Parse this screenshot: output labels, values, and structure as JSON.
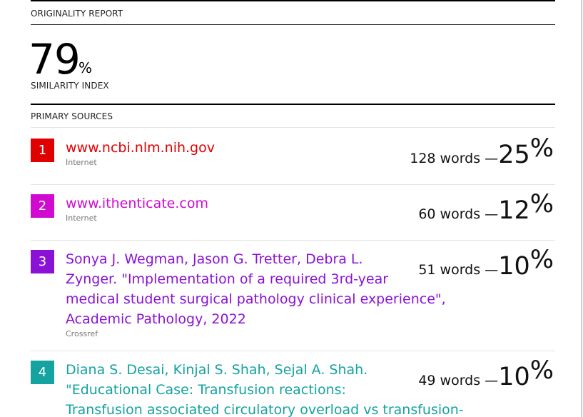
{
  "report": {
    "header_label": "ORIGINALITY REPORT",
    "similarity_value": "79",
    "similarity_unit": "%",
    "similarity_label": "SIMILARITY INDEX",
    "sources_label": "PRIMARY SOURCES"
  },
  "sources": [
    {
      "number": "1",
      "title_lines": [
        "www.ncbi.nlm.nih.gov"
      ],
      "type": "Internet",
      "words": "128 words —",
      "percent": "25",
      "color": "#e00000"
    },
    {
      "number": "2",
      "title_lines": [
        "www.ithenticate.com"
      ],
      "type": "Internet",
      "words": "60 words —",
      "percent": "12",
      "color": "#d10ad1"
    },
    {
      "number": "3",
      "title_lines": [
        "Sonya J. Wegman, Jason G. Tretter, Debra L.",
        "Zynger. \"Implementation of a required 3rd-year",
        "medical student surgical pathology clinical experience\",",
        "Academic Pathology, 2022"
      ],
      "type": "Crossref",
      "words": "51 words —",
      "percent": "10",
      "color": "#8a12d6"
    },
    {
      "number": "4",
      "title_lines": [
        "Diana S. Desai, Kinjal S. Shah, Sejal A. Shah.",
        "\"Educational Case: Transfusion reactions:",
        "Transfusion associated circulatory overload vs transfusion-"
      ],
      "type": "",
      "words": "49 words —",
      "percent": "10",
      "color": "#14a3a0"
    }
  ]
}
